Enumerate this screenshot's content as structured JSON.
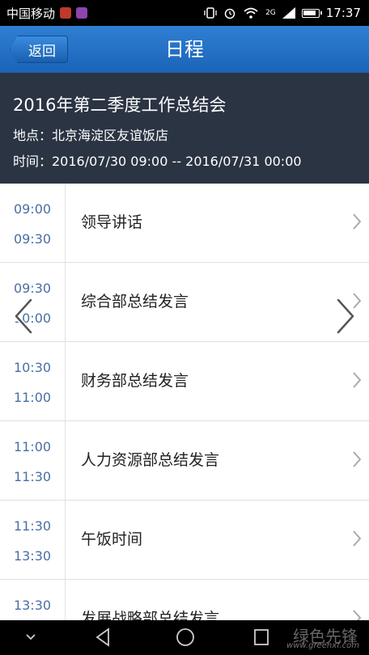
{
  "status_bar": {
    "carrier": "中国移动",
    "network": "2G",
    "time": "17:37"
  },
  "nav": {
    "back_label": "返回",
    "title": "日程"
  },
  "event": {
    "title": "2016年第二季度工作总结会",
    "location": "地点：北京海淀区友谊饭店",
    "time": "时间：2016/07/30 09:00 -- 2016/07/31 00:00"
  },
  "agenda": [
    {
      "start": "09:00",
      "end": "09:30",
      "label": "领导讲话"
    },
    {
      "start": "09:30",
      "end": "10:00",
      "label": "综合部总结发言"
    },
    {
      "start": "10:30",
      "end": "11:00",
      "label": "财务部总结发言"
    },
    {
      "start": "11:00",
      "end": "11:30",
      "label": "人力资源部总结发言"
    },
    {
      "start": "11:30",
      "end": "13:30",
      "label": "午饭时间"
    },
    {
      "start": "13:30",
      "end": "",
      "label": "发展战略部总结发言"
    }
  ],
  "watermark": {
    "brand": "绿色先锋",
    "url": "www.greenxf.com"
  },
  "colors": {
    "nav_blue": "#1b64b8",
    "header_dark": "#2b3443",
    "time_text": "#4a6fa5"
  }
}
